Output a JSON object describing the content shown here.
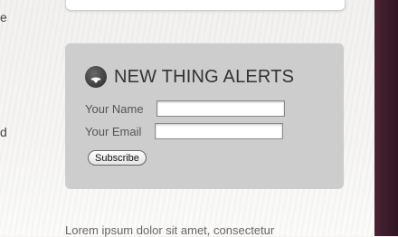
{
  "left_column": {
    "char_top": "e",
    "char_mid": "d"
  },
  "alerts": {
    "title": "NEW THING ALERTS",
    "icon": "rss-icon",
    "name_label": "Your Name",
    "email_label": "Your Email",
    "name_value": "",
    "email_value": "",
    "subscribe_label": "Subscribe"
  },
  "body_text": "Lorem ipsum dolor sit amet, consectetur",
  "colors": {
    "panel_bg": "#cdcdcd",
    "sidebar_strip": "#3a1a2a",
    "title_text": "#333333"
  }
}
